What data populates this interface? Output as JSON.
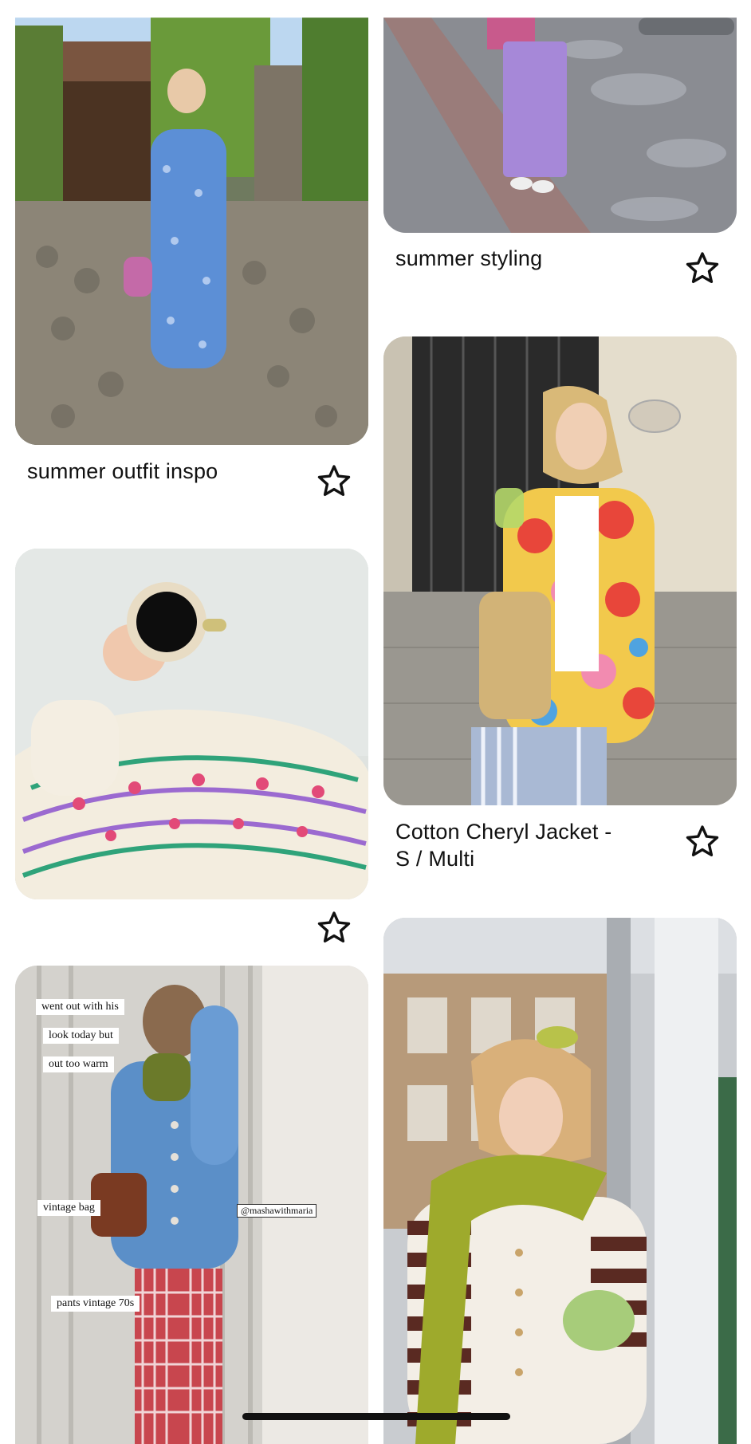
{
  "pins": {
    "pin1": {
      "caption": "summer outfit inspo",
      "star_icon": "star-outline-icon"
    },
    "pin2": {
      "caption": "summer styling",
      "star_icon": "star-outline-icon"
    },
    "pin3": {
      "caption": "Cotton Cheryl Jacket - S / Multi",
      "caption_line1": "Cotton Cheryl Jacket -",
      "caption_line2": "S / Multi",
      "star_icon": "star-outline-icon"
    },
    "pin4": {
      "caption": "",
      "star_icon": "star-outline-icon"
    },
    "pin5": {
      "overlay_texts": [
        "went out with his",
        "look today but",
        "out too warm",
        "vintage bag",
        "@mashawithmaria",
        "pants vintage 70s"
      ]
    },
    "pin6": {}
  },
  "colors": {
    "text": "#111111",
    "background": "#ffffff"
  }
}
